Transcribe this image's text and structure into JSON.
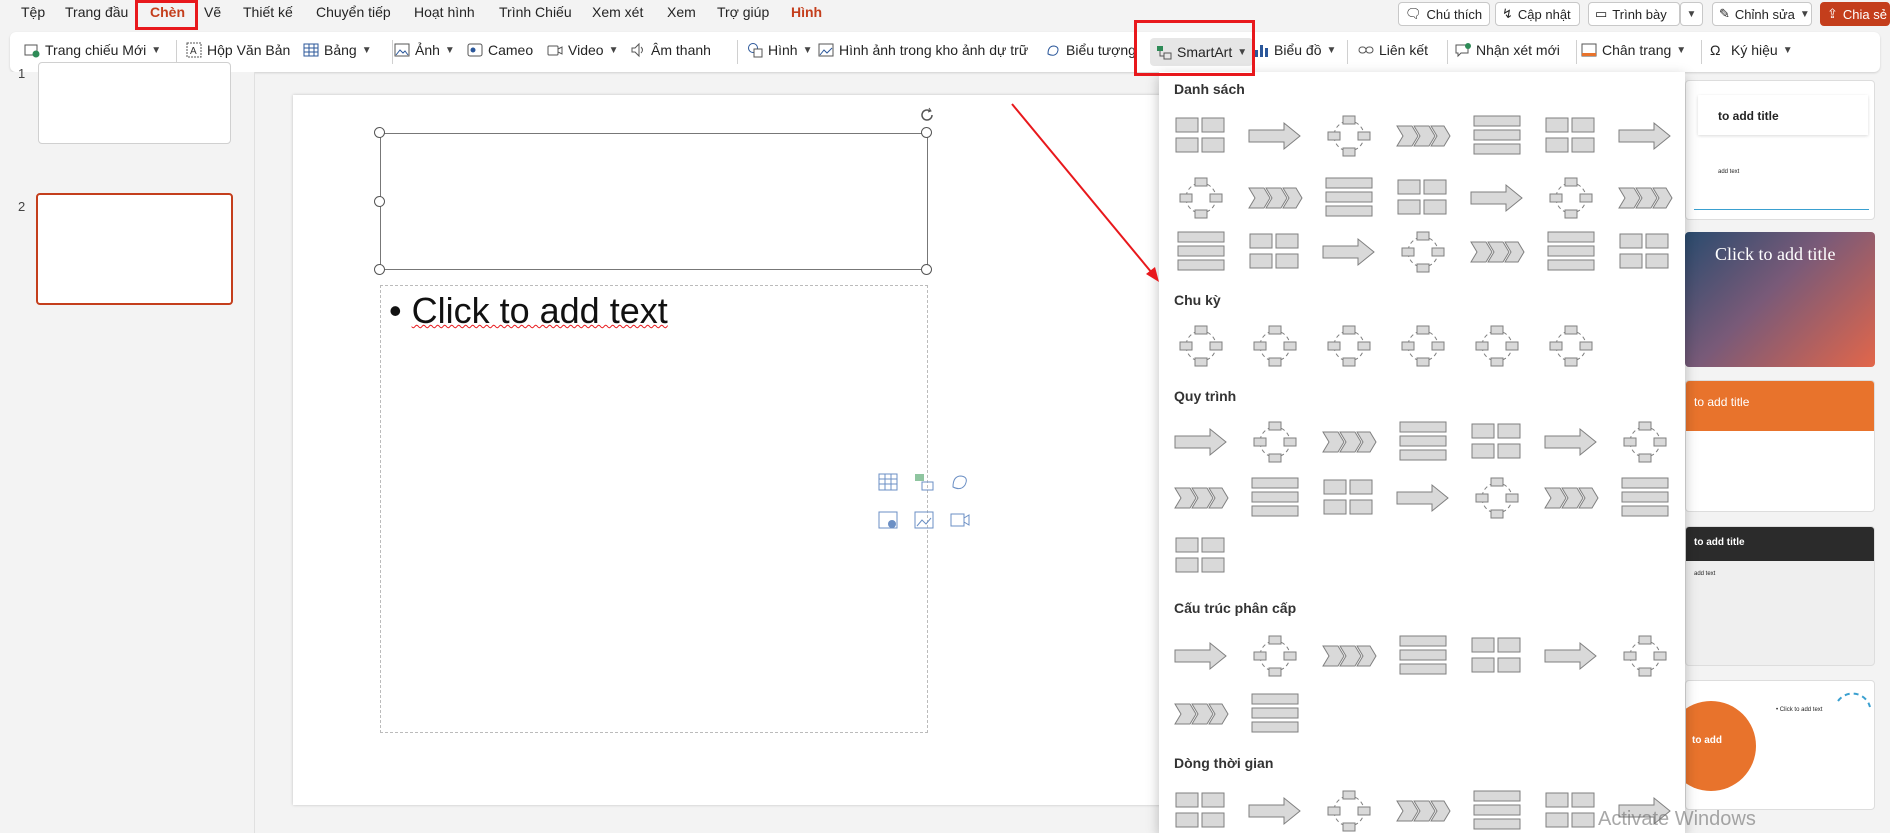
{
  "menu": {
    "items": [
      "Tệp",
      "Trang đầu",
      "Chèn",
      "Vẽ",
      "Thiết kế",
      "Chuyển tiếp",
      "Hoạt hình",
      "Trình Chiếu",
      "Xem xét",
      "Xem",
      "Trợ giúp",
      "Hình"
    ],
    "right": {
      "comment": "Chú thích",
      "update": "Cập nhật",
      "present": "Trình bày",
      "edit": "Chỉnh sửa",
      "share": "Chia sẻ"
    }
  },
  "ribbon": {
    "new_slide": "Trang chiếu Mới",
    "textbox": "Hộp Văn Bản",
    "table": "Bảng",
    "image": "Ảnh",
    "cameo": "Cameo",
    "video": "Video",
    "audio": "Âm thanh",
    "shapes": "Hình",
    "stock_images": "Hình ảnh trong kho ảnh dự trữ",
    "icons": "Biểu tượng",
    "smartart": "SmartArt",
    "chart": "Biểu đồ",
    "link": "Liên kết",
    "new_comment": "Nhận xét mới",
    "footer": "Chân trang",
    "symbols": "Ký hiệu"
  },
  "thumbs": {
    "slide1_num": "1",
    "slide2_num": "2"
  },
  "slide": {
    "body_placeholder": "Click to add text"
  },
  "smartart_gallery": {
    "categories": {
      "list": "Danh sách",
      "cycle": "Chu kỳ",
      "process": "Quy trình",
      "hierarchy": "Cấu trúc phân cấp",
      "timeline": "Dòng thời gian"
    }
  },
  "right_thumbs": {
    "t1": "to add title",
    "t1_sub": "add text",
    "t2": "Click to add title",
    "t3": "to add title",
    "t4": "to add title",
    "t4_sub": "add text",
    "t5": "to add",
    "t5_sub": "• Click to add text"
  },
  "watermark": "Activate Windows",
  "colors": {
    "accent": "#c43e1c",
    "highlight_box": "#e8181c",
    "orange_theme": "#e8732c"
  }
}
